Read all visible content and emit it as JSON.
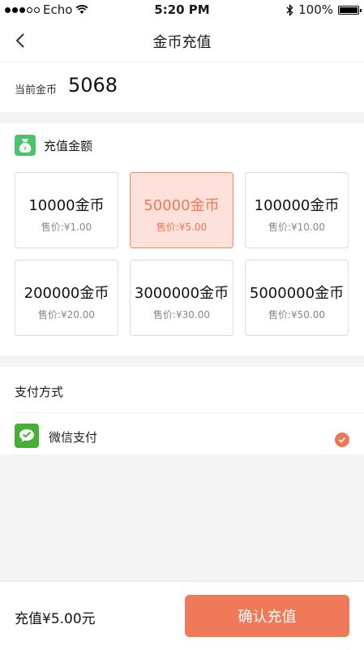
{
  "status_bar": {
    "carrier": "Echo",
    "time": "5:20 PM",
    "battery": "100%"
  },
  "nav": {
    "title": "金币充值"
  },
  "current": {
    "label": "当前金币",
    "value": "5068"
  },
  "amount_section": {
    "title": "充值金额",
    "options": [
      {
        "coins": "10000金币",
        "price": "售价:¥1.00",
        "selected": false
      },
      {
        "coins": "50000金币",
        "price": "售价:¥5.00",
        "selected": true
      },
      {
        "coins": "100000金币",
        "price": "售价:¥10.00",
        "selected": false
      },
      {
        "coins": "200000金币",
        "price": "售价:¥20.00",
        "selected": false
      },
      {
        "coins": "3000000金币",
        "price": "售价:¥30.00",
        "selected": false
      },
      {
        "coins": "5000000金币",
        "price": "售价:¥50.00",
        "selected": false
      }
    ]
  },
  "payment": {
    "title": "支付方式",
    "method": "微信支付",
    "selected": true
  },
  "footer": {
    "total": "充值¥5.00元",
    "confirm_label": "确认充值"
  },
  "colors": {
    "accent": "#ef7a59",
    "selected_bg": "#fde1da",
    "wechat_green": "#46b035",
    "icon_green": "#49c46a"
  }
}
